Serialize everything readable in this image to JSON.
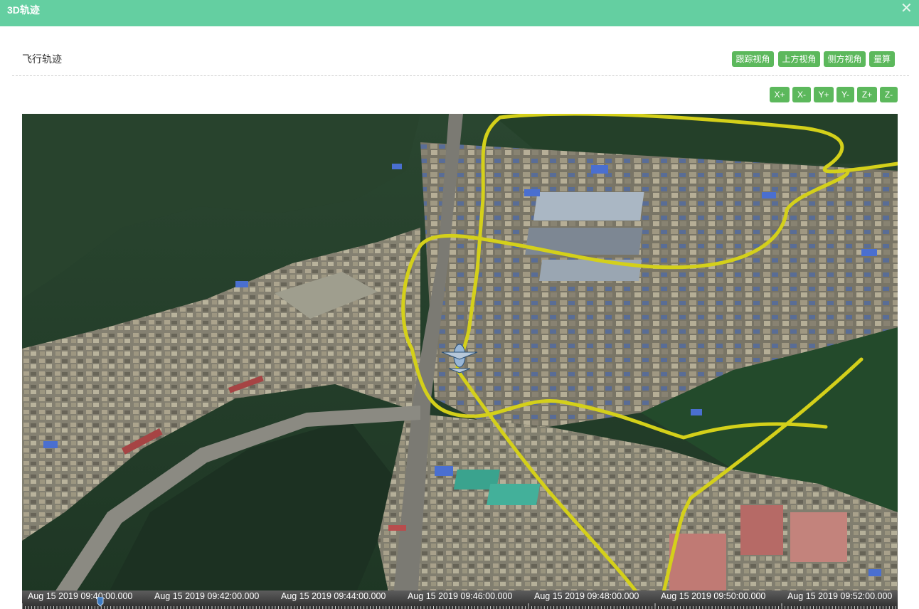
{
  "window": {
    "title": "3D轨迹",
    "close_icon": "close-icon",
    "bar_color": "#64cfa1"
  },
  "panel": {
    "section_title": "飞行轨迹"
  },
  "view_buttons": [
    "跟踪视角",
    "上方视角",
    "侧方视角",
    "量算"
  ],
  "axis_buttons": [
    "X+",
    "X-",
    "Y+",
    "Y-",
    "Z+",
    "Z-"
  ],
  "button_color": "#5cb85c",
  "map": {
    "type": "satellite-3d",
    "track_color": "#d4d01a",
    "aircraft_icon": "aircraft-icon"
  },
  "timeline": {
    "labels": [
      "Aug 15 2019 09:40:00.000",
      "Aug 15 2019 09:42:00.000",
      "Aug 15 2019 09:44:00.000",
      "Aug 15 2019 09:46:00.000",
      "Aug 15 2019 09:48:00.000",
      "Aug 15 2019 09:50:00.000",
      "Aug 15 2019 09:52:00.000"
    ],
    "scrubber_icon": "playhead-icon"
  }
}
